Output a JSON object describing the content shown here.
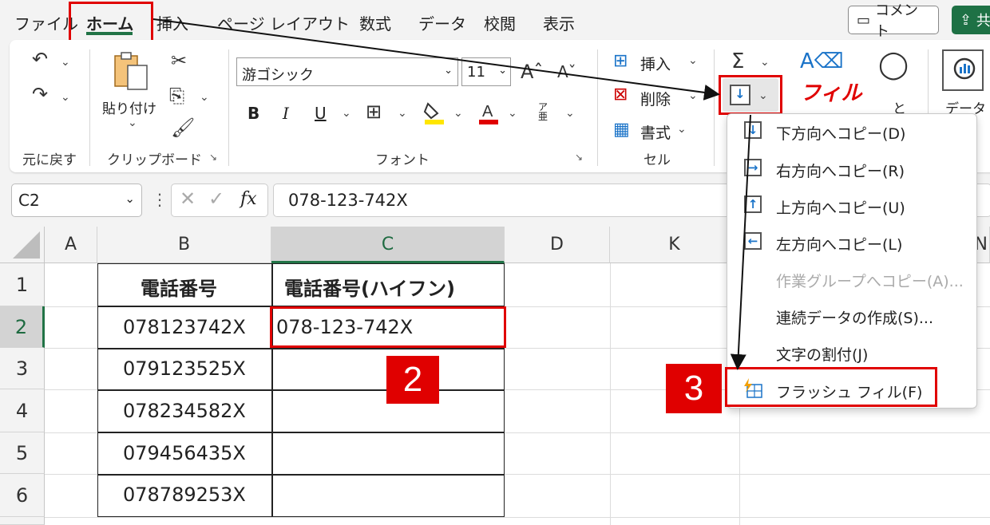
{
  "menu": {
    "items": [
      "ファイル",
      "ホーム",
      "挿入",
      "ページ レイアウト",
      "数式",
      "データ",
      "校閲",
      "表示"
    ],
    "comment_label": "コメント",
    "share_label": "共"
  },
  "ribbon": {
    "undo_group": "元に戻す",
    "clipboard": {
      "paste_label": "貼り付け",
      "group_label": "クリップボード"
    },
    "font": {
      "font_name": "游ゴシック",
      "font_size": "11",
      "group_label": "フォント",
      "bold": "B",
      "italic": "I",
      "underline": "U",
      "phonetic": "ア亜"
    },
    "cells": {
      "insert": "挿入",
      "delete": "削除",
      "format": "書式",
      "group_label": "セル"
    },
    "editing": {
      "sum": "Σ",
      "fill_annotation": "フィル",
      "sort_partial": "と",
      "data_label": "データ"
    }
  },
  "formula_bar": {
    "cell_ref": "C2",
    "fx": "fx",
    "value": "078-123-742X"
  },
  "grid": {
    "columns": [
      "A",
      "B",
      "C",
      "D",
      "K",
      "N"
    ],
    "rows": [
      "1",
      "2",
      "3",
      "4",
      "5",
      "6"
    ],
    "header_b": "電話番号",
    "header_c": "電話番号(ハイフン)",
    "phones": [
      "078123742X",
      "079123525X",
      "078234582X",
      "079456435X",
      "078789253X"
    ],
    "c2_value": "078-123-742X"
  },
  "fill_menu": {
    "items": [
      {
        "label": "下方向へコピー(D)",
        "icon": "fill-down-icon",
        "disabled": false
      },
      {
        "label": "右方向へコピー(R)",
        "icon": "fill-right-icon",
        "disabled": false
      },
      {
        "label": "上方向へコピー(U)",
        "icon": "fill-up-icon",
        "disabled": false
      },
      {
        "label": "左方向へコピー(L)",
        "icon": "fill-left-icon",
        "disabled": false
      },
      {
        "label": "作業グループへコピー(A)...",
        "icon": "",
        "disabled": true
      },
      {
        "label": "連続データの作成(S)...",
        "icon": "",
        "disabled": false
      },
      {
        "label": "文字の割付(J)",
        "icon": "",
        "disabled": false
      },
      {
        "label": "フラッシュ フィル(F)",
        "icon": "flash-fill-icon",
        "disabled": false
      }
    ]
  },
  "annotations": {
    "step2": "2",
    "step3": "3",
    "highlight_color": "#e00000"
  }
}
